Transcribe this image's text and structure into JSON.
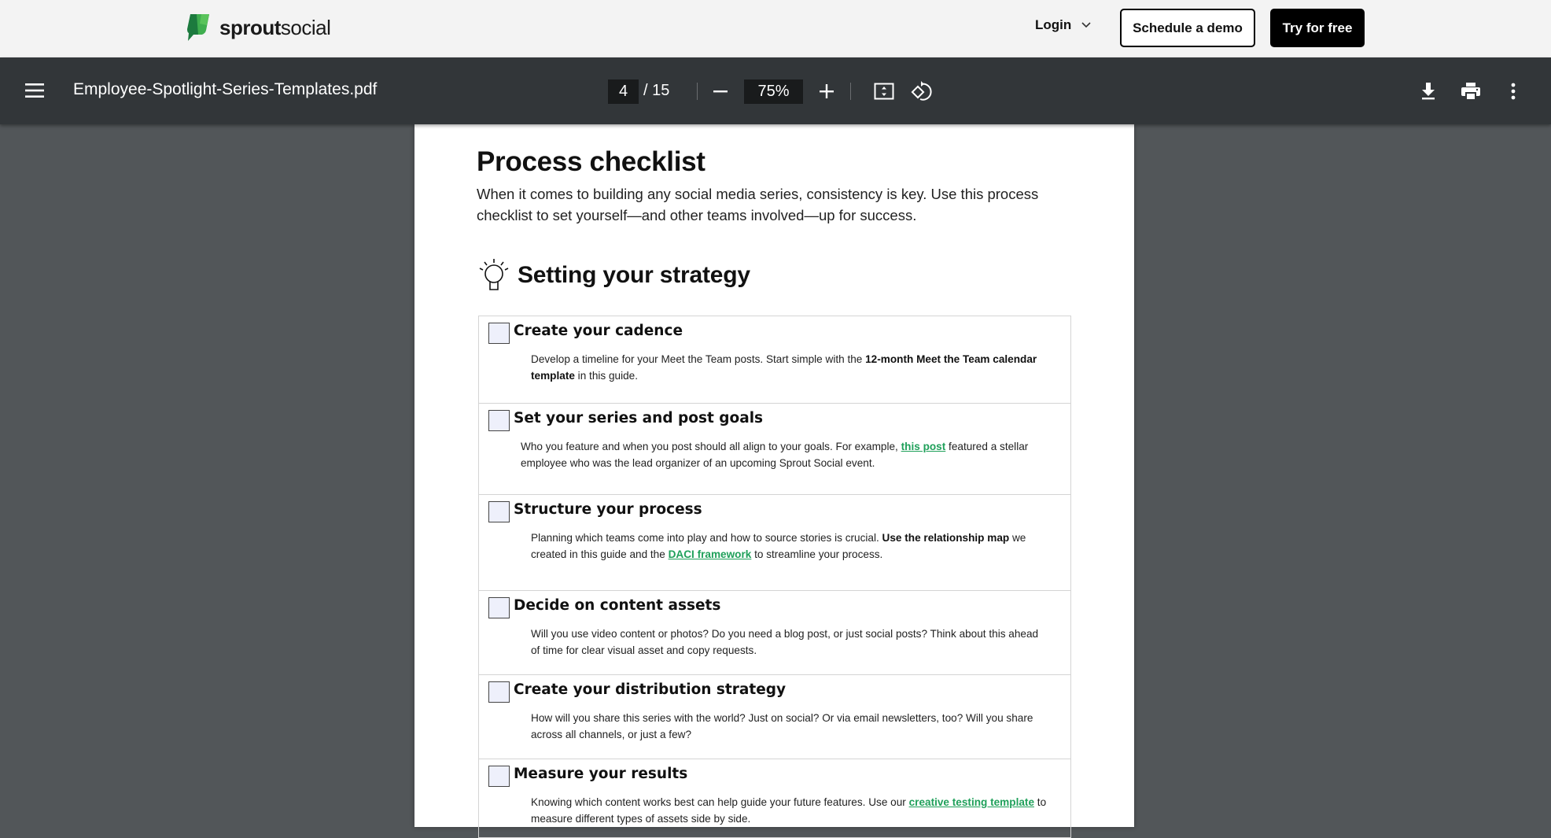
{
  "site": {
    "brand_bold": "sprout",
    "brand_regular": "social",
    "brand_colors": {
      "dark": "#1c7a3e",
      "mid": "#3fae4f",
      "light": "#59c35b"
    },
    "login_label": "Login",
    "schedule_demo_label": "Schedule a demo",
    "try_free_label": "Try for free"
  },
  "viewer": {
    "file_name": "Employee-Spotlight-Series-Templates.pdf",
    "current_page": "4",
    "total_pages": "/ 15",
    "zoom_level": "75%",
    "icons": [
      "menu-icon",
      "zoom-out-icon",
      "zoom-in-icon",
      "fit-page-icon",
      "rotate-icon",
      "download-icon",
      "print-icon",
      "more-options-icon"
    ]
  },
  "document": {
    "title": "Process checklist",
    "intro": "When it comes to building any social media series, consistency is key. Use this process checklist to set yourself—and other teams involved—up for success.",
    "section_title": "Setting your strategy",
    "section_icon": "lightbulb-icon",
    "link_color": "#1fa05a",
    "items": [
      {
        "title": "Create your cadence",
        "desc": [
          {
            "t": "Develop a timeline for your Meet the Team posts. Start simple with the "
          },
          {
            "t": "12-month Meet the Team calendar template",
            "style": "bold"
          },
          {
            "t": " in this guide."
          }
        ]
      },
      {
        "title": "Set your series and post goals",
        "desc": [
          {
            "t": "Who you feature and when you post should all align to your goals. For example, "
          },
          {
            "t": "this post",
            "style": "link"
          },
          {
            "t": " featured a stellar employee who was the lead organizer of an upcoming Sprout Social event."
          }
        ]
      },
      {
        "title": "Structure your process",
        "desc": [
          {
            "t": "Planning which teams come into play and how to source stories is crucial. "
          },
          {
            "t": "Use the relationship map",
            "style": "bold"
          },
          {
            "t": " we created in this guide and the "
          },
          {
            "t": "DACI framework",
            "style": "link"
          },
          {
            "t": " to streamline your process."
          }
        ]
      },
      {
        "title": "Decide on content assets",
        "desc": [
          {
            "t": "Will you use video content or photos? Do you need a blog post, or just social posts? Think about this ahead of time for clear visual asset and copy requests."
          }
        ]
      },
      {
        "title": "Create your distribution strategy",
        "desc": [
          {
            "t": "How will you share this series with the world? Just on social? Or via email newsletters, too? Will you share across all channels, or just a few?"
          }
        ]
      },
      {
        "title": "Measure your results",
        "desc": [
          {
            "t": "Knowing which content works best can help guide your future features. Use our "
          },
          {
            "t": "creative testing template",
            "style": "link"
          },
          {
            "t": " to measure different types of assets side by side."
          }
        ]
      }
    ]
  }
}
